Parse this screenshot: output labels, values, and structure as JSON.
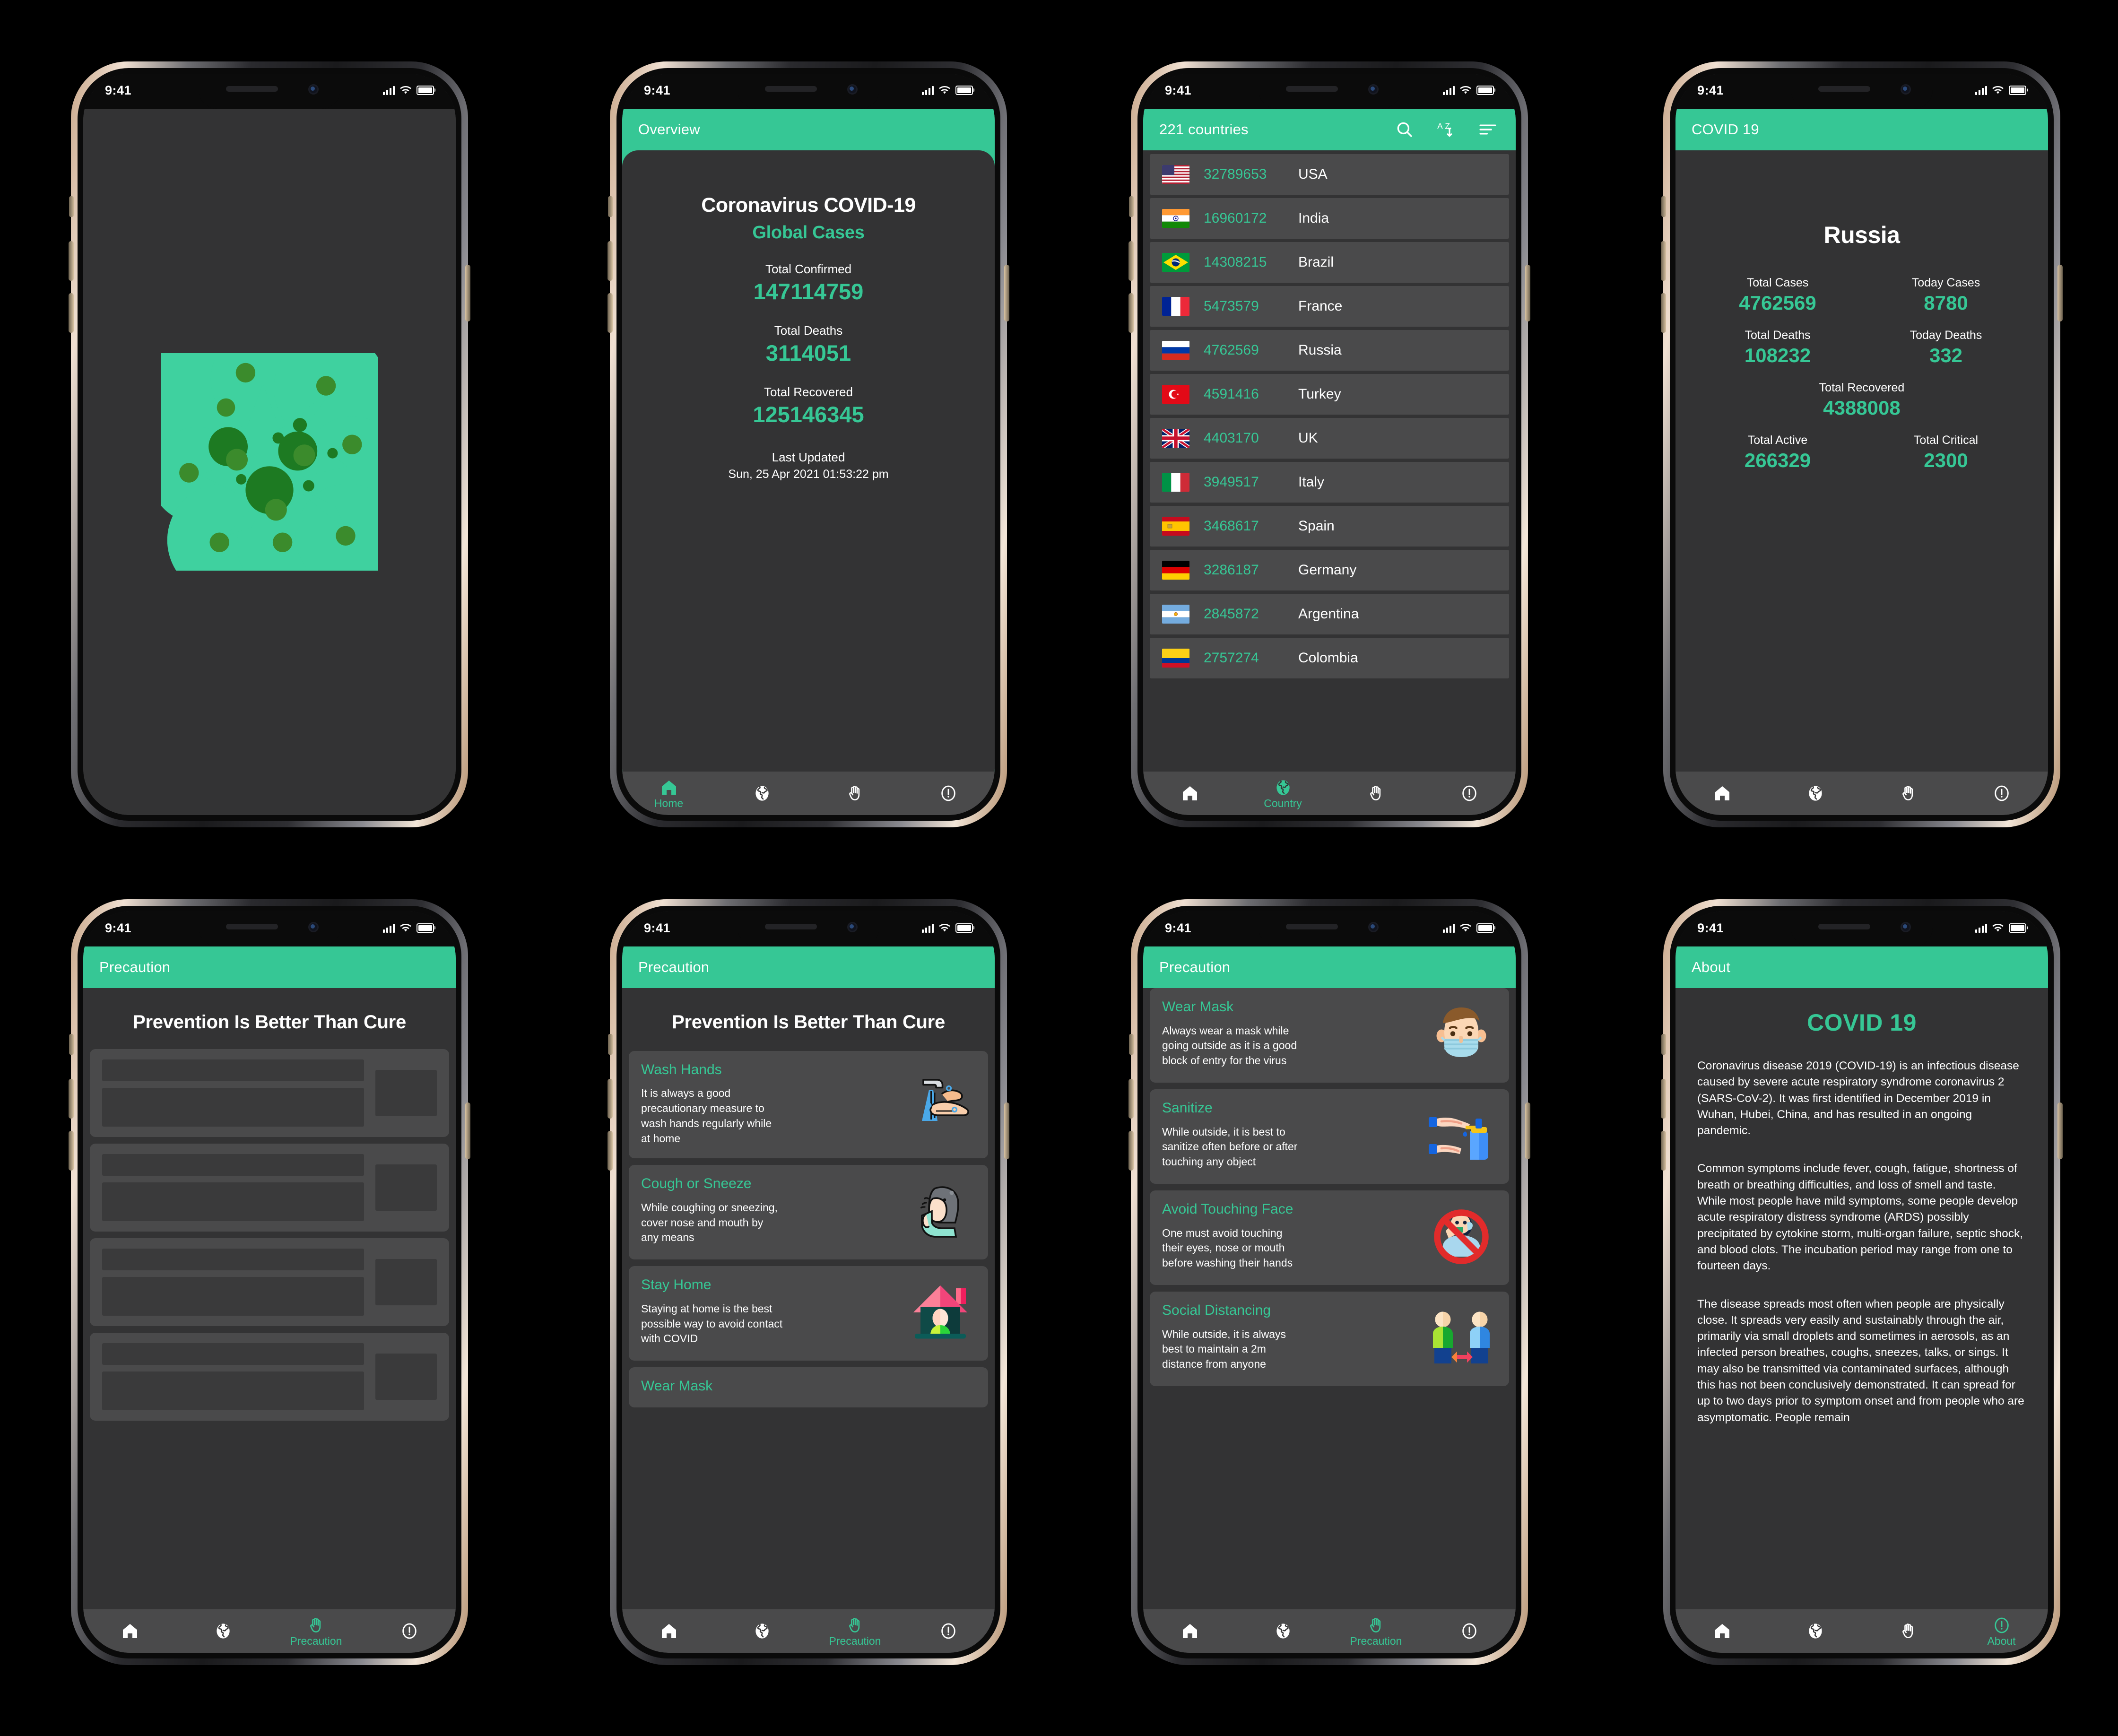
{
  "colors": {
    "accent": "#36c795",
    "screen_bg": "#333334",
    "card_bg": "#4a4a4b",
    "nav_bg": "#4a4a4b",
    "text": "#ffffff"
  },
  "status_bar": {
    "time": "9:41"
  },
  "nav": {
    "items": [
      {
        "icon": "home-icon",
        "label": "Home"
      },
      {
        "icon": "globe-icon",
        "label": "Country"
      },
      {
        "icon": "hand-icon",
        "label": "Precaution"
      },
      {
        "icon": "info-icon",
        "label": "About"
      }
    ]
  },
  "screens": [
    {
      "id": "splash",
      "name": "splash-screen",
      "logo": "virus-icon"
    },
    {
      "id": "overview",
      "name": "overview-screen",
      "appbar_title": "Overview",
      "title": "Coronavirus COVID-19",
      "subtitle": "Global Cases",
      "stats": [
        {
          "label": "Total Confirmed",
          "value": "147114759"
        },
        {
          "label": "Total Deaths",
          "value": "3114051"
        },
        {
          "label": "Total Recovered",
          "value": "125146345"
        }
      ],
      "last_updated_label": "Last Updated",
      "last_updated_value": "Sun, 25 Apr 2021 01:53:22 pm",
      "active_nav": 0
    },
    {
      "id": "countries",
      "name": "country-list-screen",
      "appbar_title": "221 countries",
      "appbar_actions": [
        "search-icon",
        "sort-alpha-icon",
        "filter-icon"
      ],
      "rows": [
        {
          "flag": "us",
          "cases": "32789653",
          "country": "USA"
        },
        {
          "flag": "in",
          "cases": "16960172",
          "country": "India"
        },
        {
          "flag": "br",
          "cases": "14308215",
          "country": "Brazil"
        },
        {
          "flag": "fr",
          "cases": "5473579",
          "country": "France"
        },
        {
          "flag": "ru",
          "cases": "4762569",
          "country": "Russia"
        },
        {
          "flag": "tr",
          "cases": "4591416",
          "country": "Turkey"
        },
        {
          "flag": "gb",
          "cases": "4403170",
          "country": "UK"
        },
        {
          "flag": "it",
          "cases": "3949517",
          "country": "Italy"
        },
        {
          "flag": "es",
          "cases": "3468617",
          "country": "Spain"
        },
        {
          "flag": "de",
          "cases": "3286187",
          "country": "Germany"
        },
        {
          "flag": "ar",
          "cases": "2845872",
          "country": "Argentina"
        },
        {
          "flag": "co",
          "cases": "2757274",
          "country": "Colombia"
        }
      ],
      "active_nav": 1
    },
    {
      "id": "detail",
      "name": "country-detail-screen",
      "appbar_title": "COVID 19",
      "country": "Russia",
      "stats": [
        {
          "label": "Total Cases",
          "value": "4762569",
          "span": "half"
        },
        {
          "label": "Today Cases",
          "value": "8780",
          "span": "half"
        },
        {
          "label": "Total Deaths",
          "value": "108232",
          "span": "half"
        },
        {
          "label": "Today Deaths",
          "value": "332",
          "span": "half"
        },
        {
          "label": "Total Recovered",
          "value": "4388008",
          "span": "full"
        },
        {
          "label": "Total Active",
          "value": "266329",
          "span": "half"
        },
        {
          "label": "Total Critical",
          "value": "2300",
          "span": "half"
        }
      ],
      "active_nav": -1
    },
    {
      "id": "precaution_loading",
      "name": "precaution-loading-screen",
      "appbar_title": "Precaution",
      "heading": "Prevention Is Better Than Cure",
      "skeleton_count": 4,
      "active_nav": 2
    },
    {
      "id": "precaution_top",
      "name": "precaution-screen-top",
      "appbar_title": "Precaution",
      "heading": "Prevention Is Better Than Cure",
      "cards": [
        {
          "title": "Wash Hands",
          "desc": "It is always a good precautionary measure to wash hands regularly while at home",
          "art": "washing-hands-icon"
        },
        {
          "title": "Cough or Sneeze",
          "desc": "While coughing or sneezing, cover nose and mouth by any means",
          "art": "coughing-person-icon"
        },
        {
          "title": "Stay Home",
          "desc": "Staying at home is the best possible way to avoid contact with COVID",
          "art": "house-person-icon"
        },
        {
          "title": "Wear Mask",
          "desc": "",
          "art": "masked-face-icon"
        }
      ],
      "active_nav": 2
    },
    {
      "id": "precaution_bottom",
      "name": "precaution-screen-bottom",
      "appbar_title": "Precaution",
      "cards": [
        {
          "title": "Wear Mask",
          "desc": "Always wear a mask while going outside as it is a good block of entry for the virus",
          "art": "masked-face-icon"
        },
        {
          "title": "Sanitize",
          "desc": "While outside, it is best to sanitize often before or after touching any object",
          "art": "sanitizer-icon"
        },
        {
          "title": "Avoid Touching Face",
          "desc": "One must avoid touching their eyes, nose or mouth before washing their hands",
          "art": "no-face-touch-icon"
        },
        {
          "title": "Social Distancing",
          "desc": "While outside, it is always best to maintain a 2m distance from anyone",
          "art": "social-distance-icon"
        }
      ],
      "active_nav": 2
    },
    {
      "id": "about",
      "name": "about-screen",
      "appbar_title": "About",
      "heading": "COVID 19",
      "paragraphs": [
        "Coronavirus disease 2019 (COVID-19) is an infectious disease caused by severe acute respiratory syndrome coronavirus 2 (SARS-CoV-2). It was first identified in December 2019 in Wuhan, Hubei, China, and has resulted in an ongoing pandemic.",
        "Common symptoms include fever, cough, fatigue, shortness of breath or breathing difficulties, and loss of smell and taste. While most people have mild symptoms, some people develop acute respiratory distress syndrome (ARDS) possibly precipitated by cytokine storm, multi-organ failure, septic shock, and blood clots. The incubation period may range from one to fourteen days.",
        "The disease spreads most often when people are physically close. It spreads very easily and sustainably through the air, primarily via small droplets and sometimes in aerosols, as an infected person breathes, coughs, sneezes, talks, or sings. It may also be transmitted via contaminated surfaces, although this has not been conclusively demonstrated. It can spread for up to two days prior to symptom onset and from people who are asymptomatic. People remain"
      ],
      "active_nav": 3
    }
  ]
}
